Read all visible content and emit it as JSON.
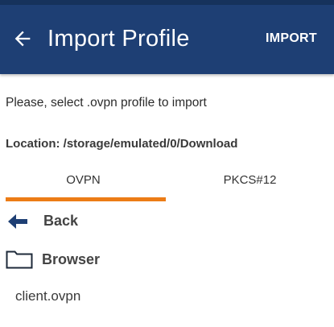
{
  "header": {
    "title": "Import Profile",
    "action_label": "IMPORT",
    "back_icon": "arrow-left-icon",
    "bg_color": "#1e3f74"
  },
  "instruction": "Please, select .ovpn profile to import",
  "location": "Location: /storage/emulated/0/Download",
  "tabs": [
    {
      "label": "OVPN",
      "selected": true
    },
    {
      "label": "PKCS#12",
      "selected": false
    }
  ],
  "accent_color": "#ec7c16",
  "list": {
    "back": {
      "label": "Back",
      "icon": "arrow-left-icon"
    },
    "browser": {
      "label": "Browser",
      "icon": "folder-icon"
    },
    "file": {
      "label": "client.ovpn"
    }
  }
}
